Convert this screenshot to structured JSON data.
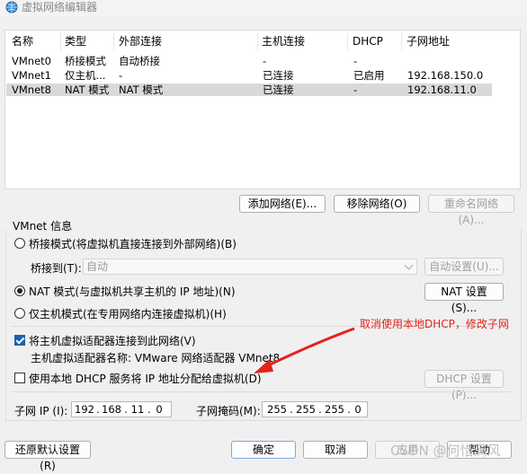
{
  "window": {
    "title": "虚拟网络编辑器",
    "icon": "network-globe-icon"
  },
  "table": {
    "headers": [
      "名称",
      "类型",
      "外部连接",
      "主机连接",
      "DHCP",
      "子网地址"
    ],
    "rows": [
      {
        "name": "VMnet0",
        "type": "桥接模式",
        "external": "自动桥接",
        "host": "-",
        "dhcp": "-",
        "subnet": ""
      },
      {
        "name": "VMnet1",
        "type": "仅主机...",
        "external": "-",
        "host": "已连接",
        "dhcp": "已启用",
        "subnet": "192.168.150.0"
      },
      {
        "name": "VMnet8",
        "type": "NAT 模式",
        "external": "NAT 模式",
        "host": "已连接",
        "dhcp": "-",
        "subnet": "192.168.11.0"
      }
    ],
    "selected_row": "VMnet8"
  },
  "table_actions": {
    "add": "添加网络(E)...",
    "remove": "移除网络(O)",
    "rename": "重命名网络(A)..."
  },
  "vmnet_info": {
    "legend": "VMnet 信息",
    "bridge_radio": "桥接模式(将虚拟机直接连接到外部网络)(B)",
    "bridge_to_label": "桥接到(T):",
    "bridge_to_value": "自动",
    "auto_settings": "自动设置(U)...",
    "nat_radio": "NAT 模式(与虚拟机共享主机的 IP 地址)(N)",
    "nat_settings": "NAT 设置(S)...",
    "hostonly_radio": "仅主机模式(在专用网络内连接虚拟机)(H)",
    "connect_adapter": "将主机虚拟适配器连接到此网络(V)",
    "adapter_name": "主机虚拟适配器名称: VMware 网络适配器 VMnet8",
    "use_dhcp": "使用本地 DHCP 服务将 IP 地址分配给虚拟机(D)",
    "dhcp_settings": "DHCP 设置(P)...",
    "subnet_ip_label": "子网 IP (I):",
    "subnet_ip": [
      "192",
      "168",
      "11",
      "0"
    ],
    "subnet_mask_label": "子网掩码(M):",
    "subnet_mask": [
      "255",
      "255",
      "255",
      "0"
    ]
  },
  "state": {
    "mode": "nat",
    "connect_adapter_checked": true,
    "use_dhcp_checked": false
  },
  "annotation": {
    "text": "取消使用本地DHCP，修改子网",
    "color": "#e2241a"
  },
  "footer": {
    "restore": "还原默认设置(R)",
    "ok": "确定",
    "cancel": "取消",
    "apply": "应用",
    "help": "帮助"
  },
  "watermark": "CSDN @何惜满风"
}
